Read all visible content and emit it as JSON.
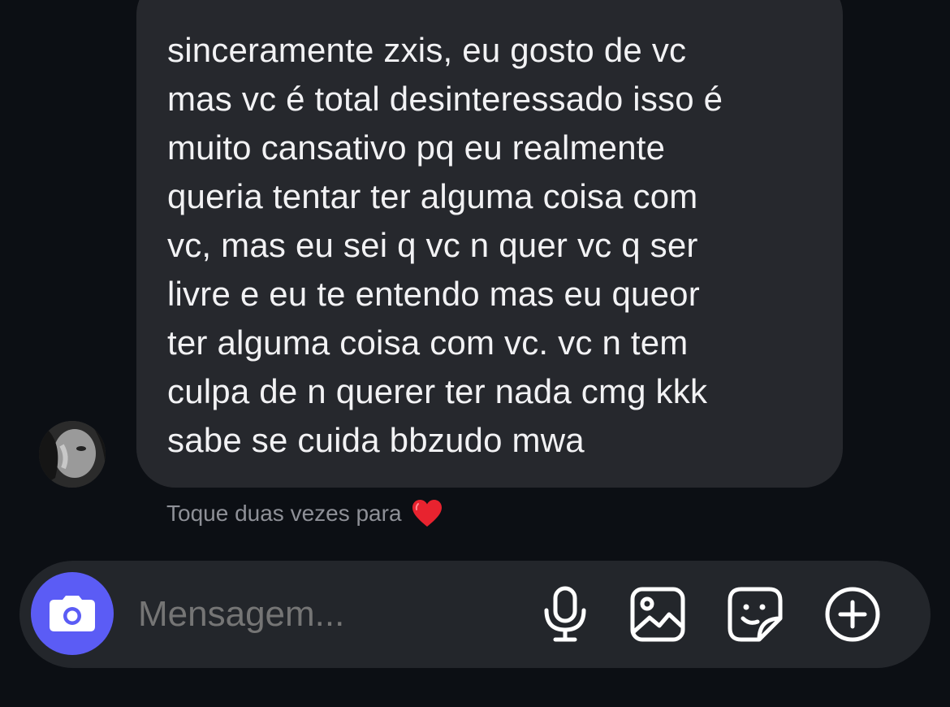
{
  "message": {
    "lines": [
      "sinceramente zxis, eu gosto de vc",
      "mas vc é total desinteressado isso é",
      "muito cansativo pq eu realmente",
      "queria tentar ter alguma coisa com",
      "vc, mas eu sei q vc n quer vc q ser",
      "livre e eu te entendo mas eu queor",
      "ter alguma coisa com vc. vc n tem",
      "culpa de n querer ter nada cmg kkk",
      "sabe se cuida bbzudo mwa"
    ],
    "reaction_hint": "Toque duas vezes para",
    "reaction_icon": "red-heart-icon"
  },
  "composer": {
    "placeholder": "Mensagem...",
    "camera_icon": "camera-icon",
    "icons": [
      "microphone-icon",
      "image-icon",
      "sticker-icon",
      "plus-circle-icon"
    ]
  },
  "colors": {
    "background": "#0c0f14",
    "bubble": "#26282d",
    "accent": "#5b5cf5",
    "heart": "#e8232f"
  }
}
